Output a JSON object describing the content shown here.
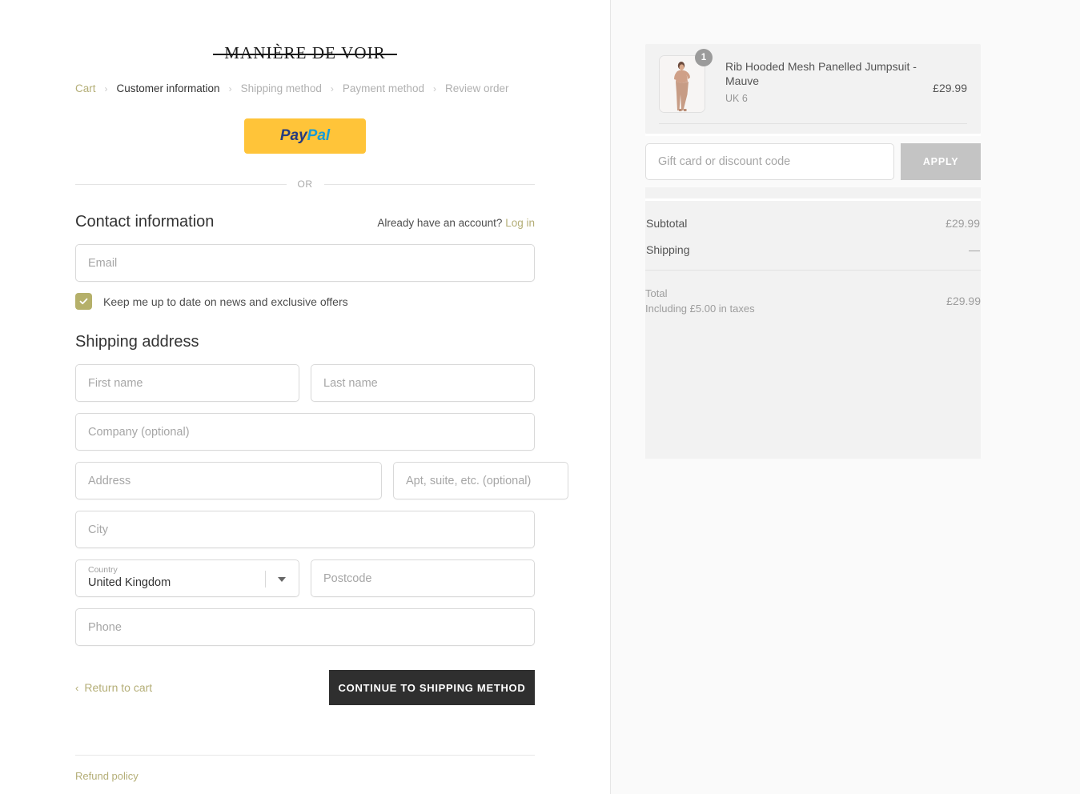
{
  "brand": {
    "logo_text": "MANIÈRE DE VOIR",
    "accent_color": "#b4ae77",
    "dark_color": "#2f2f2f"
  },
  "breadcrumb": {
    "separator": "›",
    "items": [
      {
        "label": "Cart",
        "state": "link"
      },
      {
        "label": "Customer information",
        "state": "current"
      },
      {
        "label": "Shipping method",
        "state": "todo"
      },
      {
        "label": "Payment method",
        "state": "todo"
      },
      {
        "label": "Review order",
        "state": "todo"
      }
    ]
  },
  "express": {
    "paypal_pay": "Pay",
    "paypal_pal": "Pal",
    "divider_label": "OR"
  },
  "contact": {
    "title": "Contact information",
    "account_prompt": "Already have an account?",
    "login_label": "Log in",
    "email_placeholder": "Email",
    "newsletter_label": "Keep me up to date on news and exclusive offers",
    "newsletter_checked": true
  },
  "shipping": {
    "title": "Shipping address",
    "first_name_placeholder": "First name",
    "last_name_placeholder": "Last name",
    "company_placeholder": "Company (optional)",
    "address_placeholder": "Address",
    "apt_placeholder": "Apt, suite, etc. (optional)",
    "city_placeholder": "City",
    "country_label": "Country",
    "country_value": "United Kingdom",
    "postcode_placeholder": "Postcode",
    "phone_placeholder": "Phone"
  },
  "actions": {
    "return_chevron": "‹",
    "return_label": "Return to cart",
    "continue_label": "CONTINUE TO SHIPPING METHOD"
  },
  "footer": {
    "refund_policy": "Refund policy"
  },
  "summary": {
    "product": {
      "name": "Rib Hooded Mesh Panelled Jumpsuit - Mauve",
      "variant": "UK 6",
      "quantity": "1",
      "price": "£29.99"
    },
    "discount": {
      "placeholder": "Gift card or discount code",
      "apply_label": "APPLY"
    },
    "totals": [
      {
        "label": "Subtotal",
        "value": "£29.99"
      },
      {
        "label": "Shipping",
        "value": "—"
      }
    ],
    "grand_total": {
      "label": "Total",
      "tax_note": "Including £5.00 in taxes",
      "value": "£29.99"
    }
  }
}
